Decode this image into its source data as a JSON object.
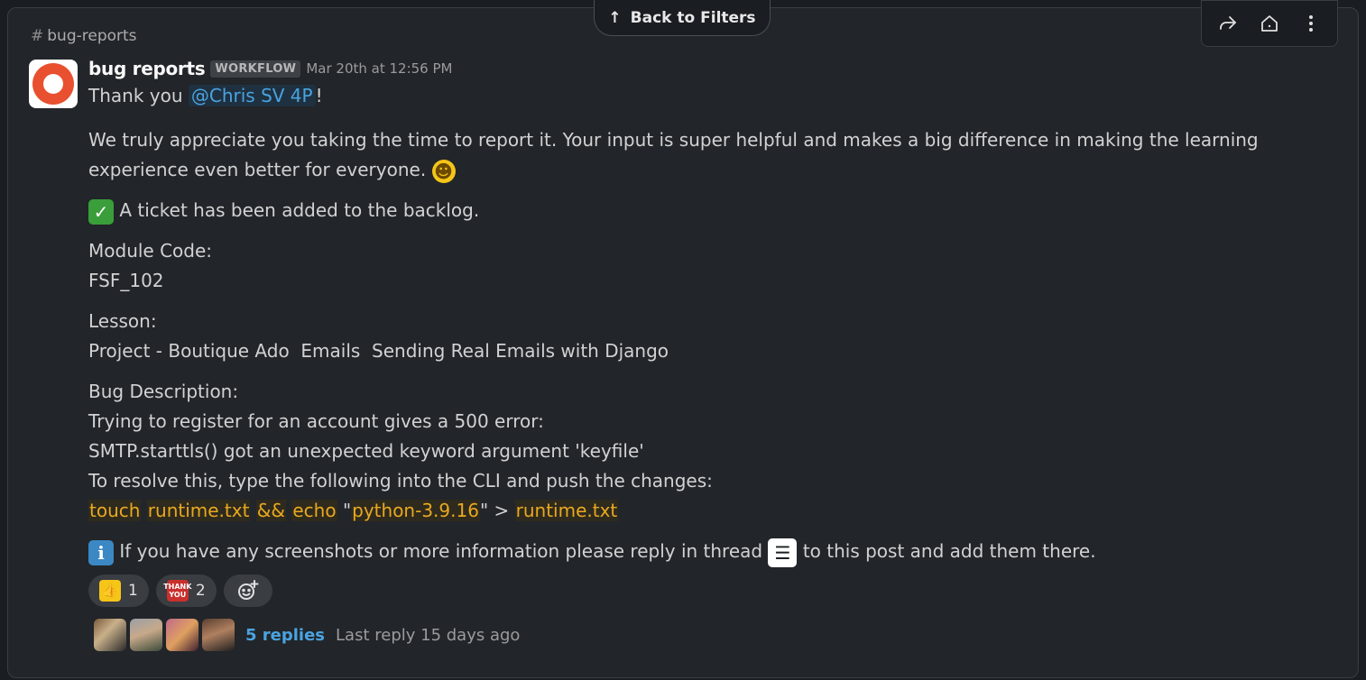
{
  "channel": {
    "name": "bug-reports"
  },
  "nav": {
    "back_label": "Back to Filters"
  },
  "toolbar": {
    "share_icon": "share-icon",
    "home_icon": "home-icon",
    "more_icon": "more-vertical-icon"
  },
  "message": {
    "sender": "bug reports",
    "badge": "WORKFLOW",
    "timestamp": "Mar 20th at 12:56 PM",
    "greeting_prefix": "Thank you",
    "mention": "@Chris SV 4P",
    "greeting_suffix": "!",
    "appreciation_line1": "We truly appreciate you taking the time to report it. Your input is super helpful and makes a big difference in making the learning",
    "appreciation_line2": "experience even better for everyone.",
    "ticket_text": "A ticket has been added to the backlog.",
    "module_label": "Module Code:",
    "module_value": "FSF_102",
    "lesson_label": "Lesson:",
    "lesson_value": "Project - Boutique Ado  Emails  Sending Real Emails with Django",
    "bug_label": "Bug Description:",
    "bug_line1": "Trying to register for an account gives a 500 error:",
    "bug_line2": "SMTP.starttls() got an unexpected keyword argument 'keyfile'",
    "bug_line3": "To resolve this, type the following into the CLI and push the changes:",
    "code": {
      "touch": "touch",
      "file1": "runtime.txt",
      "and": "&&",
      "echo": "echo",
      "q1": "\"",
      "version": "python-3.9.16",
      "q2": "\"",
      "gt": " > ",
      "file2": "runtime.txt"
    },
    "info_before": "If you have any screenshots or more information please reply in thread",
    "info_after": "to this post and add them there."
  },
  "reactions": [
    {
      "emoji": "thumbs-up",
      "count": "1"
    },
    {
      "emoji": "thank-you",
      "label": "THANK YOU",
      "count": "2"
    }
  ],
  "thread": {
    "replies": "5 replies",
    "last_reply": "Last reply 15 days ago"
  },
  "colors": {
    "background": "#1a1d21",
    "card": "#222529",
    "mention": "#4aa3e0",
    "code": "#e8a920",
    "avatar_orange": "#e8502f"
  }
}
